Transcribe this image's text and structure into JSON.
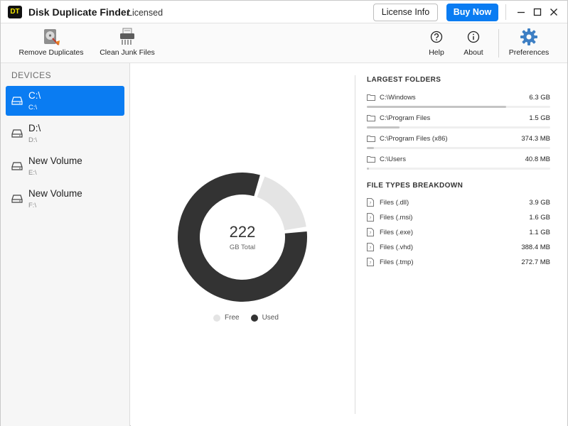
{
  "titlebar": {
    "logo_text": "DT",
    "app_name": "Disk Duplicate Finder",
    "license_status": "Licensed",
    "license_button": "License Info",
    "buy_button": "Buy Now"
  },
  "toolbar": {
    "remove_duplicates": "Remove Duplicates",
    "clean_junk": "Clean Junk Files",
    "help": "Help",
    "about": "About",
    "preferences": "Preferences"
  },
  "sidebar": {
    "heading": "DEVICES",
    "devices": [
      {
        "name": "C:\\",
        "path": "C:\\",
        "selected": true
      },
      {
        "name": "D:\\",
        "path": "D:\\",
        "selected": false
      },
      {
        "name": "New Volume",
        "path": "E:\\",
        "selected": false
      },
      {
        "name": "New Volume",
        "path": "F:\\",
        "selected": false
      }
    ]
  },
  "disk_usage": {
    "total": "222",
    "total_label": "GB Total",
    "used_fraction": 0.82,
    "legend": [
      {
        "label": "Free",
        "color": "#e4e4e4"
      },
      {
        "label": "Used",
        "color": "#333333"
      }
    ]
  },
  "largest_folders": {
    "heading": "LARGEST FOLDERS",
    "items": [
      {
        "path": "C:\\Windows",
        "size": "6.3 GB",
        "fraction": 0.76
      },
      {
        "path": "C:\\Program Files",
        "size": "1.5 GB",
        "fraction": 0.18
      },
      {
        "path": "C:\\Program Files (x86)",
        "size": "374.3 MB",
        "fraction": 0.04
      },
      {
        "path": "C:\\Users",
        "size": "40.8 MB",
        "fraction": 0.01
      }
    ]
  },
  "file_types": {
    "heading": "FILE TYPES BREAKDOWN",
    "items": [
      {
        "label": "Files (.dll)",
        "size": "3.9 GB"
      },
      {
        "label": "Files (.msi)",
        "size": "1.6 GB"
      },
      {
        "label": "Files (.exe)",
        "size": "1.1 GB"
      },
      {
        "label": "Files (.vhd)",
        "size": "388.4 MB"
      },
      {
        "label": "Files (.tmp)",
        "size": "272.7 MB"
      }
    ]
  },
  "colors": {
    "accent": "#0a7cf2",
    "used": "#333333",
    "free": "#e4e4e4"
  }
}
